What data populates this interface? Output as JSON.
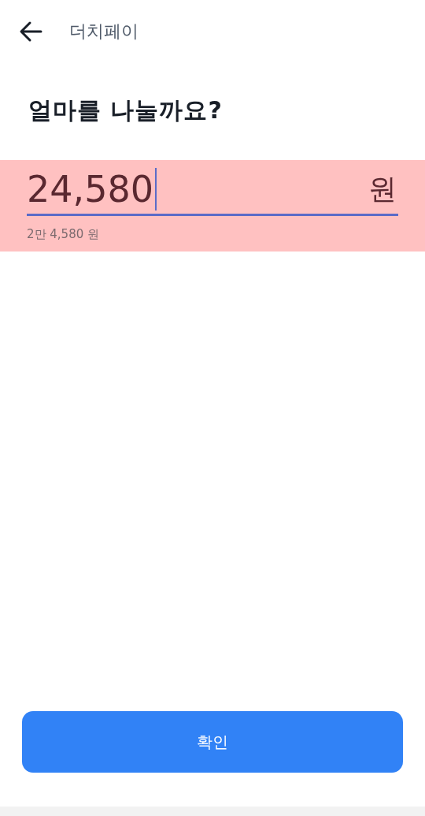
{
  "header": {
    "title": "더치페이"
  },
  "heading": "얼마를 나눌까요?",
  "amount_field": {
    "value": "24,580",
    "unit": "원",
    "focused": true,
    "highlighted": true
  },
  "amount_hint": "2만 4,580 원",
  "confirm_button": {
    "label": "확인"
  }
}
